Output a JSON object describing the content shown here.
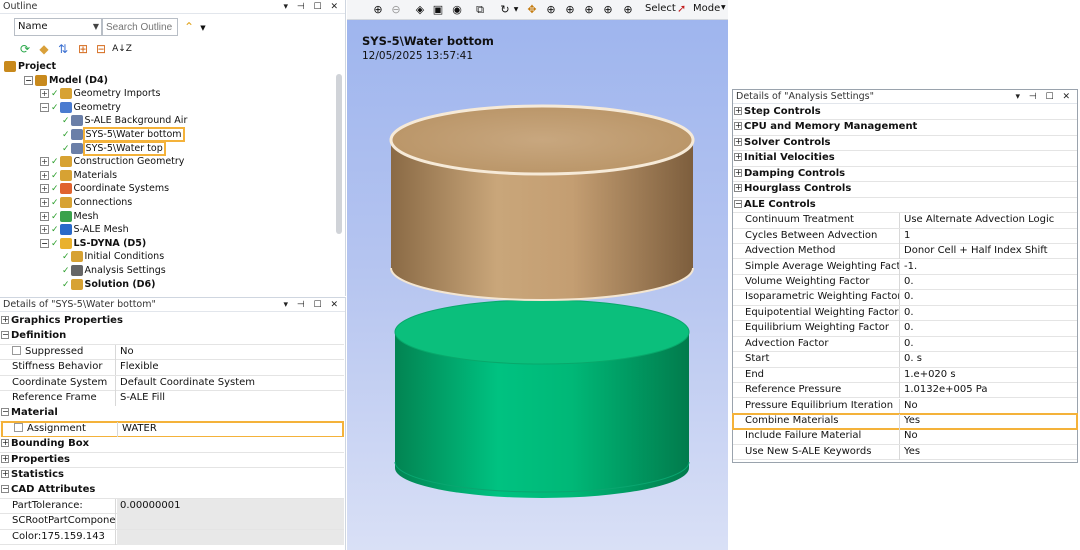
{
  "outline": {
    "title": "Outline",
    "name_select": "Name",
    "search_placeholder": "Search Outline",
    "sort_label": "A↓Z",
    "tree": [
      {
        "label": "Project",
        "bold": true,
        "level": 0,
        "icon": "project-icon"
      },
      {
        "label": "Model (D4)",
        "bold": true,
        "level": 1,
        "icon": "model-icon"
      },
      {
        "label": "Geometry Imports",
        "level": 2,
        "icon": "geometry-imports-icon"
      },
      {
        "label": "Geometry",
        "level": 2,
        "icon": "geometry-icon"
      },
      {
        "label": "S-ALE Background Air",
        "level": 3,
        "icon": "body-icon"
      },
      {
        "label": "SYS-5\\Water bottom",
        "level": 3,
        "icon": "body-icon",
        "highlight": true
      },
      {
        "label": "SYS-5\\Water top",
        "level": 3,
        "icon": "body-icon",
        "highlight": true
      },
      {
        "label": "Construction Geometry",
        "level": 2,
        "icon": "construction-geometry-icon"
      },
      {
        "label": "Materials",
        "level": 2,
        "icon": "materials-icon"
      },
      {
        "label": "Coordinate Systems",
        "level": 2,
        "icon": "coordinate-systems-icon"
      },
      {
        "label": "Connections",
        "level": 2,
        "icon": "connections-icon"
      },
      {
        "label": "Mesh",
        "level": 2,
        "icon": "mesh-icon"
      },
      {
        "label": "S-ALE Mesh",
        "level": 2,
        "icon": "sale-mesh-icon"
      },
      {
        "label": "LS-DYNA (D5)",
        "bold": true,
        "level": 2,
        "icon": "ls-dyna-icon"
      },
      {
        "label": "Initial Conditions",
        "level": 3,
        "icon": "initial-conditions-icon"
      },
      {
        "label": "Analysis Settings",
        "level": 3,
        "icon": "analysis-settings-icon"
      },
      {
        "label": "Solution (D6)",
        "bold": true,
        "level": 3,
        "icon": "solution-icon"
      }
    ]
  },
  "details_body": {
    "title": "Details of \"SYS-5\\Water bottom\"",
    "rows": [
      {
        "type": "group",
        "label": "Graphics Properties",
        "expanded": false
      },
      {
        "type": "group",
        "label": "Definition",
        "expanded": true
      },
      {
        "type": "prop",
        "key": "Suppressed",
        "value": "No",
        "checkbox": true
      },
      {
        "type": "prop",
        "key": "Stiffness Behavior",
        "value": "Flexible"
      },
      {
        "type": "prop",
        "key": "Coordinate System",
        "value": "Default Coordinate System"
      },
      {
        "type": "prop",
        "key": "Reference Frame",
        "value": "S-ALE Fill"
      },
      {
        "type": "group",
        "label": "Material",
        "expanded": true
      },
      {
        "type": "prop",
        "key": "Assignment",
        "value": "WATER",
        "checkbox": true,
        "highlight": true
      },
      {
        "type": "group",
        "label": "Bounding Box",
        "expanded": false
      },
      {
        "type": "group",
        "label": "Properties",
        "expanded": false
      },
      {
        "type": "group",
        "label": "Statistics",
        "expanded": false
      },
      {
        "type": "group",
        "label": "CAD Attributes",
        "expanded": true
      },
      {
        "type": "prop",
        "key": "PartTolerance:",
        "value": "0.00000001",
        "grey": true
      },
      {
        "type": "prop",
        "key": "SCRootPartComponent",
        "value": "",
        "grey": true
      },
      {
        "type": "prop",
        "key": "Color:175.159.143",
        "value": "",
        "grey": true
      }
    ]
  },
  "viewport": {
    "select_label": "Select",
    "mode_label": "Mode",
    "title": "SYS-5\\Water bottom",
    "date": "12/05/2025 13:57:41",
    "top_body_color": "#c9a67a",
    "bottom_body_color": "#00c281"
  },
  "details_analysis": {
    "title": "Details of \"Analysis Settings\"",
    "rows": [
      {
        "type": "group",
        "label": "Step Controls",
        "expanded": false
      },
      {
        "type": "group",
        "label": "CPU and Memory Management",
        "expanded": false
      },
      {
        "type": "group",
        "label": "Solver Controls",
        "expanded": false
      },
      {
        "type": "group",
        "label": "Initial Velocities",
        "expanded": false
      },
      {
        "type": "group",
        "label": "Damping Controls",
        "expanded": false
      },
      {
        "type": "group",
        "label": "Hourglass Controls",
        "expanded": false
      },
      {
        "type": "group",
        "label": "ALE Controls",
        "expanded": true
      },
      {
        "type": "prop",
        "key": "Continuum Treatment",
        "value": "Use Alternate Advection Logic"
      },
      {
        "type": "prop",
        "key": "Cycles Between Advection",
        "value": "1"
      },
      {
        "type": "prop",
        "key": "Advection Method",
        "value": "Donor Cell + Half Index Shift"
      },
      {
        "type": "prop",
        "key": "Simple Average Weighting Factor",
        "value": "-1."
      },
      {
        "type": "prop",
        "key": "Volume Weighting Factor",
        "value": "0."
      },
      {
        "type": "prop",
        "key": "Isoparametric Weighting Factor",
        "value": "0."
      },
      {
        "type": "prop",
        "key": "Equipotential Weighting Factor",
        "value": "0."
      },
      {
        "type": "prop",
        "key": "Equilibrium Weighting Factor",
        "value": "0."
      },
      {
        "type": "prop",
        "key": "Advection Factor",
        "value": "0."
      },
      {
        "type": "prop",
        "key": "Start",
        "value": "0. s"
      },
      {
        "type": "prop",
        "key": "End",
        "value": "1.e+020 s"
      },
      {
        "type": "prop",
        "key": "Reference Pressure",
        "value": "1.0132e+005 Pa"
      },
      {
        "type": "prop",
        "key": "Pressure Equilibrium Iteration",
        "value": "No"
      },
      {
        "type": "prop",
        "key": "Combine Materials",
        "value": "Yes",
        "highlight": true
      },
      {
        "type": "prop",
        "key": "Include Failure Material",
        "value": "No"
      },
      {
        "type": "prop",
        "key": "Use New S-ALE Keywords",
        "value": "Yes"
      }
    ]
  }
}
